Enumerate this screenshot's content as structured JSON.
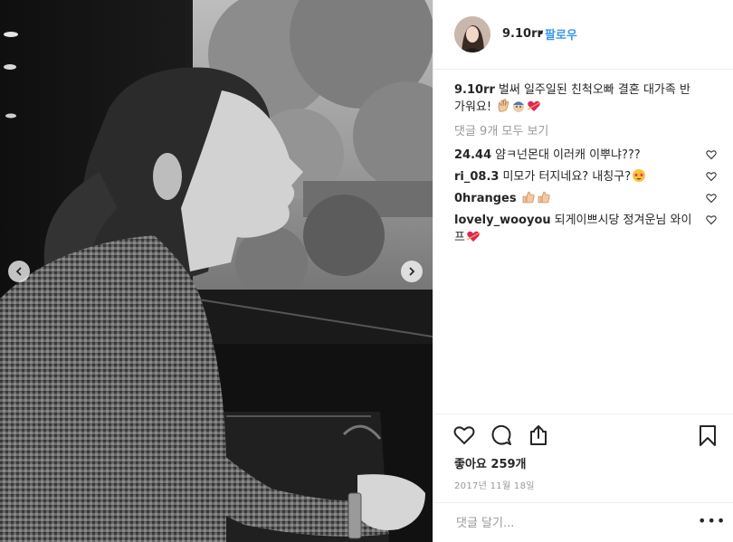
{
  "post": {
    "author": "9.10rr",
    "follow_label": "팔로우",
    "dot": "•",
    "image_alt_icon": "photo"
  },
  "caption": {
    "username": "9.10rr",
    "text": "벌써 일주일된 친척오빠 결혼 대가족 반가워요!",
    "emojis": [
      "waving-hand-icon",
      "person-emoji-icon",
      "heart-emoji-icon"
    ]
  },
  "view_all_label": "댓글 9개 모두 보기",
  "comments": [
    {
      "username": "24.44",
      "text": "얌ㅋ넌몬대 이러캐 이뿌냐???",
      "emojis": []
    },
    {
      "username": "ri_08.3",
      "text": "미모가 터지네요? 내칭구?",
      "emojis": [
        "star-eyes-emoji-icon"
      ]
    },
    {
      "username": "0hranges",
      "text": "",
      "emojis": [
        "thumbs-up-icon",
        "thumbs-up-icon"
      ]
    },
    {
      "username": "lovely_wooyou",
      "text": "되게이쁘시당 정겨운님 와이프",
      "emojis": [
        "heart-emoji-icon"
      ]
    }
  ],
  "likes_label": "좋아요 259개",
  "date_label": "2017년 11월 18일",
  "add_comment_placeholder": "댓글 달기...",
  "more_label": "•••",
  "colors": {
    "link_blue": "#3897f0",
    "text": "#262626",
    "muted": "#999999",
    "border": "#efefef",
    "heart_red": "#e0245e"
  }
}
